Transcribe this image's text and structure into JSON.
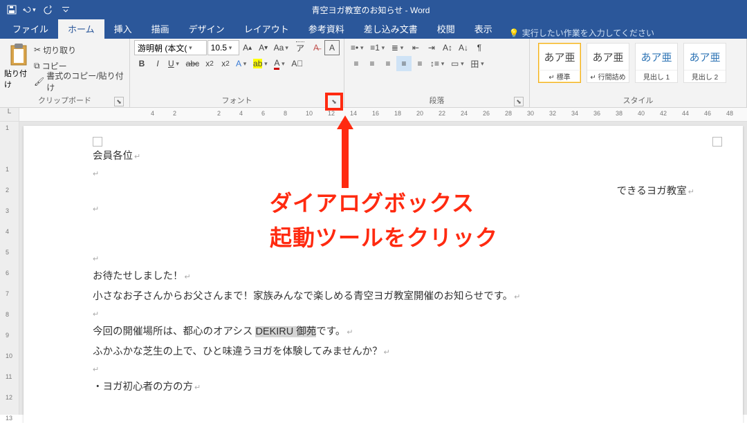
{
  "title": "青空ヨガ教室のお知らせ - Word",
  "tabs": [
    "ファイル",
    "ホーム",
    "挿入",
    "描画",
    "デザイン",
    "レイアウト",
    "参考資料",
    "差し込み文書",
    "校閲",
    "表示"
  ],
  "active_tab": 1,
  "tellme": "実行したい作業を入力してください",
  "clipboard": {
    "paste": "貼り付け",
    "cut": "切り取り",
    "copy": "コピー",
    "painter": "書式のコピー/貼り付け",
    "label": "クリップボード"
  },
  "font": {
    "name": "游明朝 (本文(",
    "size": "10.5",
    "label": "フォント"
  },
  "paragraph": {
    "label": "段落"
  },
  "styles": {
    "label": "スタイル",
    "items": [
      {
        "preview": "あア亜",
        "name": "↵ 標準",
        "sel": true,
        "blue": false
      },
      {
        "preview": "あア亜",
        "name": "↵ 行間詰め",
        "sel": false,
        "blue": false
      },
      {
        "preview": "あア亜",
        "name": "見出し 1",
        "sel": false,
        "blue": true
      },
      {
        "preview": "あア亜",
        "name": "見出し 2",
        "sel": false,
        "blue": true
      }
    ]
  },
  "ruler_h": [
    4,
    2,
    "",
    2,
    4,
    6,
    8,
    10,
    12,
    14,
    16,
    18,
    20,
    22,
    24,
    26,
    28,
    30,
    32,
    34,
    36,
    38,
    40,
    42,
    44,
    46,
    48
  ],
  "ruler_v": [
    1,
    "",
    1,
    2,
    3,
    4,
    5,
    6,
    7,
    8,
    9,
    10,
    11,
    12,
    13
  ],
  "doc": {
    "l1": "会員各位",
    "r1": "できるヨガ教室",
    "p1": "お待たせしました！",
    "p2": "小さなお子さんからお父さんまで！家族みんなで楽しめる青空ヨガ教室開催のお知らせです。",
    "p3a": "今回の開催場所は、都心のオアシス ",
    "p3sel": "DEKIRU 御苑",
    "p3b": "です。",
    "p4": "ふかふかな芝生の上で、ひと味違うヨガを体験してみませんか？",
    "p5": "・ヨガ初心者の方の方"
  },
  "annotation": {
    "l1": "ダイアログボックス",
    "l2": "起動ツールをクリック"
  },
  "colors": {
    "accent": "#2b579a",
    "red": "#ff2a10"
  }
}
